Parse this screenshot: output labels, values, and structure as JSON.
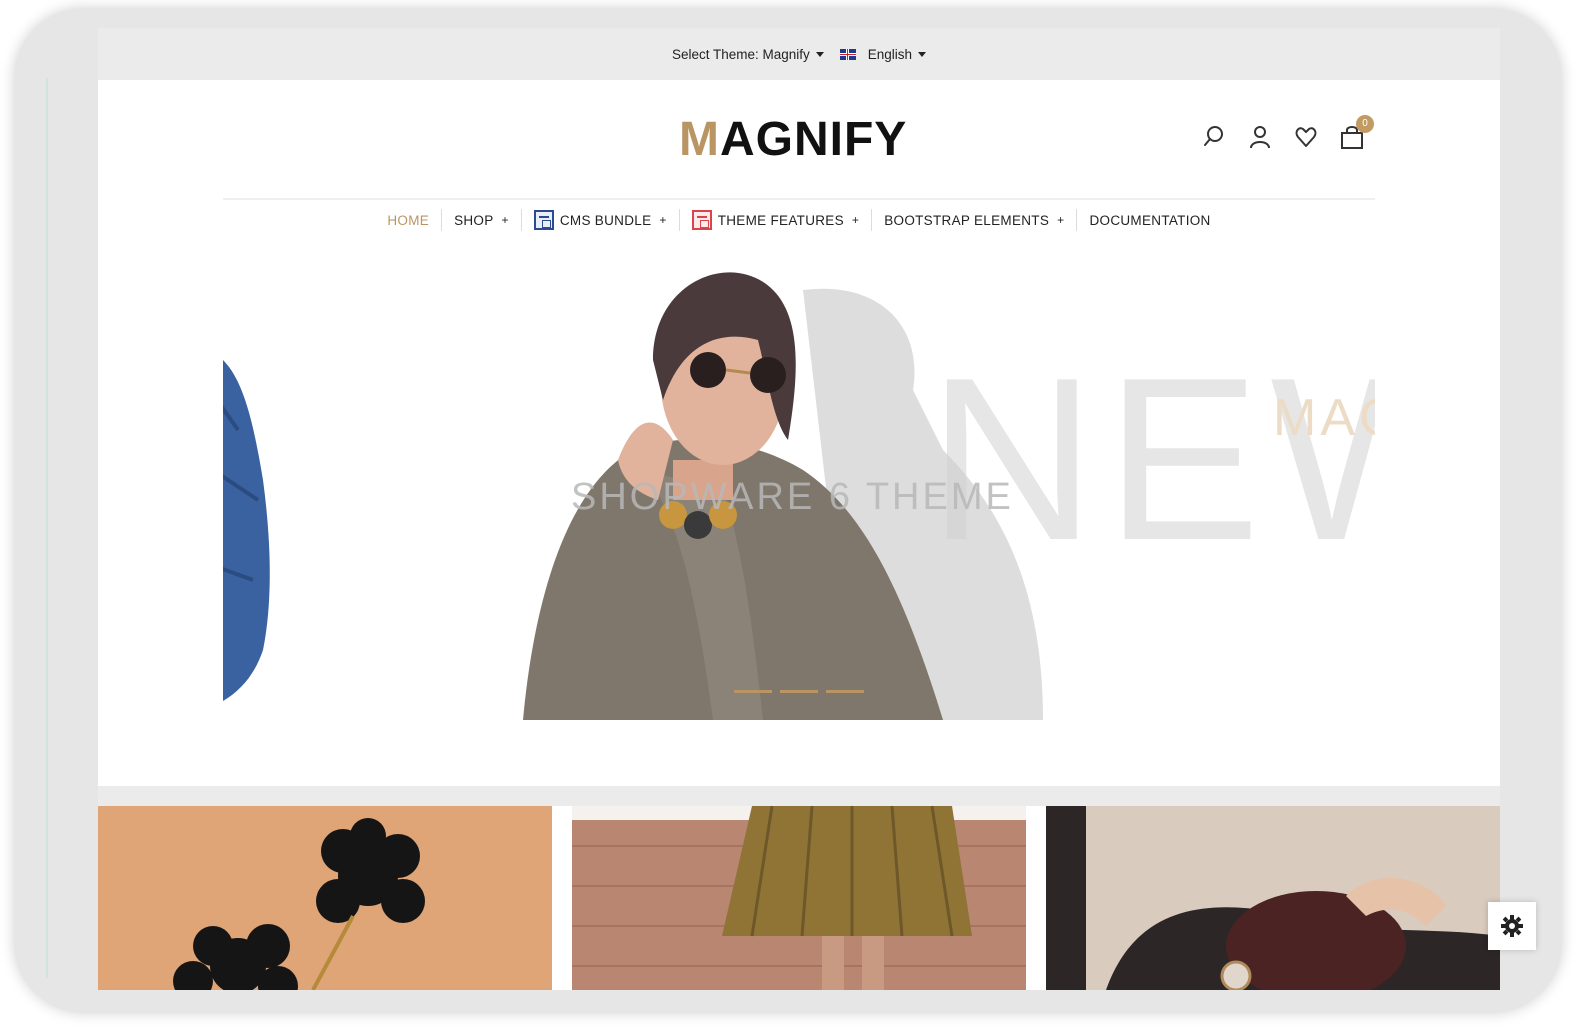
{
  "topbar": {
    "theme_label": "Select Theme: Magnify",
    "language_label": "English"
  },
  "header": {
    "logo_first": "M",
    "logo_rest": "AGNIFY",
    "cart_count": "0"
  },
  "nav": {
    "items": [
      {
        "label": "HOME"
      },
      {
        "label": "SHOP"
      },
      {
        "label": "CMS BUNDLE"
      },
      {
        "label": "THEME FEATURES"
      },
      {
        "label": "BOOTSTRAP ELEMENTS"
      },
      {
        "label": "DOCUMENTATION"
      }
    ],
    "plus": "+"
  },
  "hero": {
    "big_text": "NEW",
    "brand_text": "MAG",
    "subtitle": "SHOPWARE 6 THEME",
    "slide_count": 3
  },
  "colors": {
    "accent": "#b99564",
    "topbar_bg": "#ebebeb"
  },
  "icons": [
    "search-icon",
    "user-icon",
    "heart-icon",
    "cart-icon",
    "gear-icon"
  ]
}
